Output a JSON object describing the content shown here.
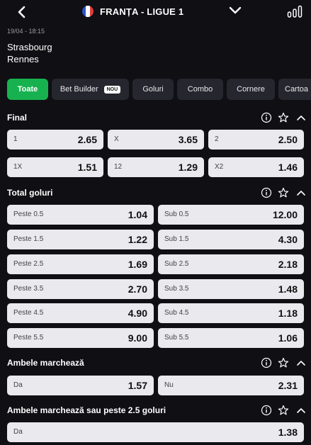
{
  "header": {
    "title": "FRANȚA - LIGUE 1",
    "flag_colors": [
      "#2e52c9",
      "#ffffff",
      "#e23b3b"
    ]
  },
  "match": {
    "datetime": "19/04 - 18:15",
    "home": "Strasbourg",
    "away": "Rennes"
  },
  "tabs": [
    {
      "label": "Toate",
      "active": true
    },
    {
      "label": "Bet Builder",
      "badge": "NOU"
    },
    {
      "label": "Goluri"
    },
    {
      "label": "Combo"
    },
    {
      "label": "Cornere"
    },
    {
      "label": "Cartoa"
    }
  ],
  "sections": {
    "final": {
      "title": "Final",
      "rows": [
        [
          {
            "label": "1",
            "odd": "2.65"
          },
          {
            "label": "X",
            "odd": "3.65"
          },
          {
            "label": "2",
            "odd": "2.50"
          }
        ],
        [
          {
            "label": "1X",
            "odd": "1.51"
          },
          {
            "label": "12",
            "odd": "1.29"
          },
          {
            "label": "X2",
            "odd": "1.46"
          }
        ]
      ]
    },
    "total": {
      "title": "Total goluri",
      "rows": [
        [
          {
            "label": "Peste 0.5",
            "odd": "1.04"
          },
          {
            "label": "Sub 0.5",
            "odd": "12.00"
          }
        ],
        [
          {
            "label": "Peste 1.5",
            "odd": "1.22"
          },
          {
            "label": "Sub 1.5",
            "odd": "4.30"
          }
        ],
        [
          {
            "label": "Peste 2.5",
            "odd": "1.69"
          },
          {
            "label": "Sub 2.5",
            "odd": "2.18"
          }
        ],
        [
          {
            "label": "Peste 3.5",
            "odd": "2.70"
          },
          {
            "label": "Sub 3.5",
            "odd": "1.48"
          }
        ],
        [
          {
            "label": "Peste 4.5",
            "odd": "4.90"
          },
          {
            "label": "Sub 4.5",
            "odd": "1.18"
          }
        ],
        [
          {
            "label": "Peste 5.5",
            "odd": "9.00"
          },
          {
            "label": "Sub 5.5",
            "odd": "1.06"
          }
        ]
      ]
    },
    "btts": {
      "title": "Ambele marchează",
      "rows": [
        [
          {
            "label": "Da",
            "odd": "1.57"
          },
          {
            "label": "Nu",
            "odd": "2.31"
          }
        ]
      ]
    },
    "btts_over": {
      "title": "Ambele marchează sau peste 2.5 goluri",
      "rows": [
        [
          {
            "label": "Da",
            "odd": "1.38"
          }
        ]
      ]
    }
  },
  "colors": {
    "background": "#0f0f14",
    "tab": "#26262e",
    "tab_active": "#17b24f",
    "odd_tile": "#e9e9ee"
  }
}
